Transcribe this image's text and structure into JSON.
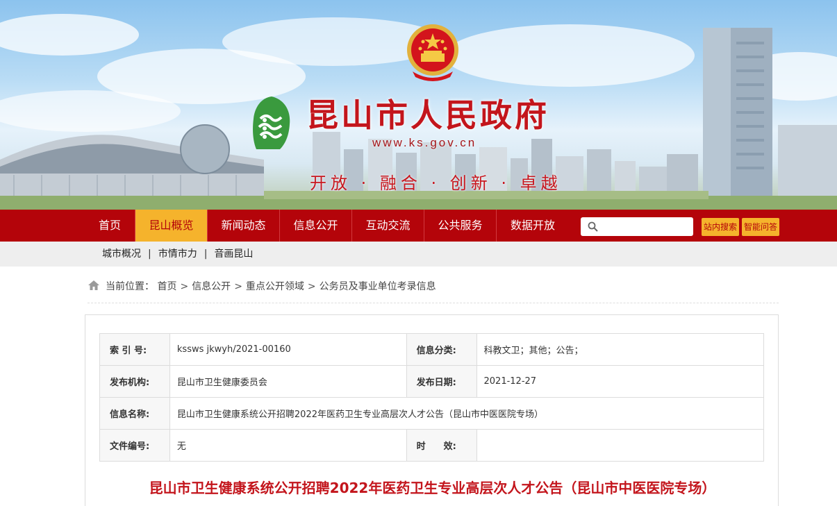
{
  "banner": {
    "title": "昆山市人民政府",
    "url": "www.ks.gov.cn",
    "slogan": "开放 · 融合 · 创新 · 卓越"
  },
  "nav": {
    "items": [
      {
        "label": "首页"
      },
      {
        "label": "昆山概览",
        "active": true
      },
      {
        "label": "新闻动态"
      },
      {
        "label": "信息公开"
      },
      {
        "label": "互动交流"
      },
      {
        "label": "公共服务"
      },
      {
        "label": "数据开放"
      }
    ],
    "search_placeholder": "",
    "site_search_label": "站内搜索",
    "smart_qa_label": "智能问答"
  },
  "subnav": {
    "items": [
      "城市概况",
      "市情市力",
      "音画昆山"
    ]
  },
  "breadcrumb": {
    "prefix": "当前位置：",
    "items": [
      "首页",
      "信息公开",
      "重点公开领域",
      "公务员及事业单位考录信息"
    ]
  },
  "meta": {
    "index_label": "索 引 号:",
    "index_value": "kssws jkwyh/2021-00160",
    "category_label": "信息分类:",
    "category_value": "科教文卫；其他；公告；",
    "publisher_label": "发布机构:",
    "publisher_value": "昆山市卫生健康委员会",
    "date_label": "发布日期:",
    "date_value": "2021-12-27",
    "name_label": "信息名称:",
    "name_value": "昆山市卫生健康系统公开招聘2022年医药卫生专业高层次人才公告（昆山市中医医院专场）",
    "docno_label": "文件编号:",
    "docno_value": "无",
    "validity_label": "时　　效:",
    "validity_value": ""
  },
  "article": {
    "title": "昆山市卫生健康系统公开招聘2022年医药卫生专业高层次人才公告（昆山市中医医院专场）"
  },
  "colors": {
    "nav_red": "#b4040a",
    "accent_yellow": "#f5b32c",
    "title_red": "#c3151c"
  }
}
